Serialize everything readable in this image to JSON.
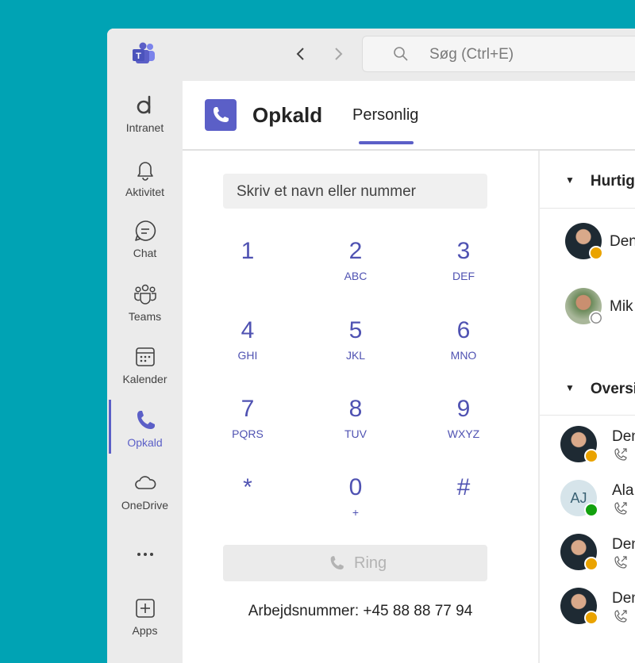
{
  "search": {
    "placeholder": "Søg (Ctrl+E)"
  },
  "rail": {
    "items": [
      {
        "label": "Intranet",
        "icon": "intranet-d-icon"
      },
      {
        "label": "Aktivitet",
        "icon": "bell-icon"
      },
      {
        "label": "Chat",
        "icon": "chat-icon"
      },
      {
        "label": "Teams",
        "icon": "teams-icon"
      },
      {
        "label": "Kalender",
        "icon": "calendar-icon"
      },
      {
        "label": "Opkald",
        "icon": "phone-icon"
      },
      {
        "label": "OneDrive",
        "icon": "cloud-icon"
      },
      {
        "label": "•••",
        "icon": "more-icon"
      },
      {
        "label": "Apps",
        "icon": "add-apps-icon"
      }
    ],
    "active": "Opkald"
  },
  "header": {
    "title": "Opkald",
    "tab": "Personlig"
  },
  "dial": {
    "input_placeholder": "Skriv et navn eller nummer",
    "keys": [
      {
        "digit": "1",
        "letters": ""
      },
      {
        "digit": "2",
        "letters": "ABC"
      },
      {
        "digit": "3",
        "letters": "DEF"
      },
      {
        "digit": "4",
        "letters": "GHI"
      },
      {
        "digit": "5",
        "letters": "JKL"
      },
      {
        "digit": "6",
        "letters": "MNO"
      },
      {
        "digit": "7",
        "letters": "PQRS"
      },
      {
        "digit": "8",
        "letters": "TUV"
      },
      {
        "digit": "9",
        "letters": "WXYZ"
      },
      {
        "digit": "*",
        "letters": ""
      },
      {
        "digit": "0",
        "letters": "+"
      },
      {
        "digit": "#",
        "letters": ""
      }
    ],
    "ring_label": "Ring",
    "work_number": "Arbejdsnummer: +45 88 88 77 94"
  },
  "side": {
    "speed_dial_header": "Hurtig",
    "speed_dial": [
      {
        "name": "Den",
        "presence": "away"
      },
      {
        "name": "Mik",
        "presence": "offline"
      }
    ],
    "overview_header": "Oversi",
    "history": [
      {
        "name": "Den",
        "presence": "away",
        "avatar": "photo"
      },
      {
        "name": "Ala",
        "presence": "available",
        "avatar": "initials",
        "initials": "AJ"
      },
      {
        "name": "Den",
        "presence": "away",
        "avatar": "photo"
      },
      {
        "name": "Den",
        "presence": "away",
        "avatar": "photo"
      }
    ]
  },
  "colors": {
    "accent": "#5b5fc7",
    "background": "#00a3b4",
    "away": "#eaa300",
    "available": "#13a10e"
  }
}
